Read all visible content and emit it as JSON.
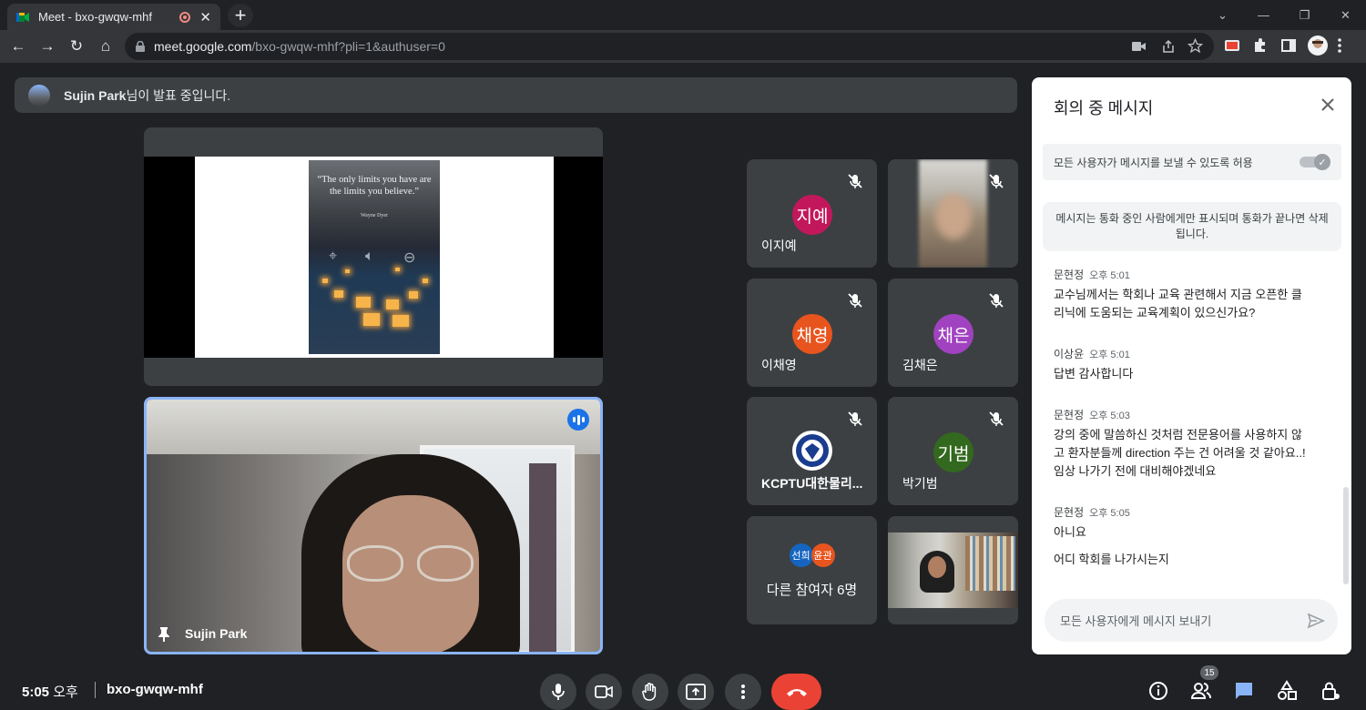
{
  "browser": {
    "tab_title": "Meet - bxo-gwqw-mhf",
    "url_host": "meet.google.com",
    "url_path": "/bxo-gwqw-mhf?pli=1&authuser=0"
  },
  "presenting": {
    "name": "Sujin Park",
    "suffix": "님이 발표 중입니다."
  },
  "screen_share": {
    "quote": "“The only limits you have are the limits you believe.”",
    "author": "Wayne Dyer"
  },
  "main_speaker": {
    "name": "Sujin Park"
  },
  "tiles": [
    {
      "initial": "지예",
      "name": "이지예",
      "color": "#c2185b"
    },
    {
      "initial": "",
      "name": "",
      "color": ""
    },
    {
      "initial": "채영",
      "name": "이채영",
      "color": "#e8541e"
    },
    {
      "initial": "채은",
      "name": "김채은",
      "color": "#a142c0"
    },
    {
      "initial": "",
      "name": "KCPTU대한물리...",
      "color": ""
    },
    {
      "initial": "기범",
      "name": "박기범",
      "color": "#33691e"
    },
    {
      "others_label": "다른 참여자 6명",
      "a1": "선희",
      "a1_color": "#1565c0",
      "a2": "윤관",
      "a2_color": "#e8541e"
    }
  ],
  "chat": {
    "title": "회의 중 메시지",
    "permission_label": "모든 사용자가 메시지를 보낼 수 있도록 허용",
    "notice": "메시지는 통화 중인 사람에게만 표시되며 통화가 끝나면 삭제됩니다.",
    "messages": [
      {
        "sender": "문현정",
        "time": "오후 5:01",
        "lines": [
          "교수님께서는 학회나 교육 관련해서 지금 오픈한 클",
          "리닉에 도움되는 교육계획이 있으신가요?"
        ]
      },
      {
        "sender": "이상윤",
        "time": "오후 5:01",
        "lines": [
          "답변 감사합니다"
        ]
      },
      {
        "sender": "문현정",
        "time": "오후 5:03",
        "lines": [
          "강의 중에 말씀하신 것처럼 전문용어를 사용하지 않",
          "고 환자분들께 direction 주는 건 어려울 것 같아요..!",
          "임상 나가기 전에 대비해야겠네요"
        ]
      },
      {
        "sender": "문현정",
        "time": "오후 5:05",
        "lines": [
          "아니요",
          "어디 학회를 나가시는지"
        ]
      }
    ],
    "input_placeholder": "모든 사용자에게 메시지 보내기"
  },
  "bottom": {
    "time": "5:05",
    "ampm": "오후",
    "meeting_code": "bxo-gwqw-mhf",
    "participants_count": "15"
  },
  "colors": {
    "accent": "#8ab4f8",
    "end_call": "#ea4335",
    "speaking": "#1a73e8"
  }
}
